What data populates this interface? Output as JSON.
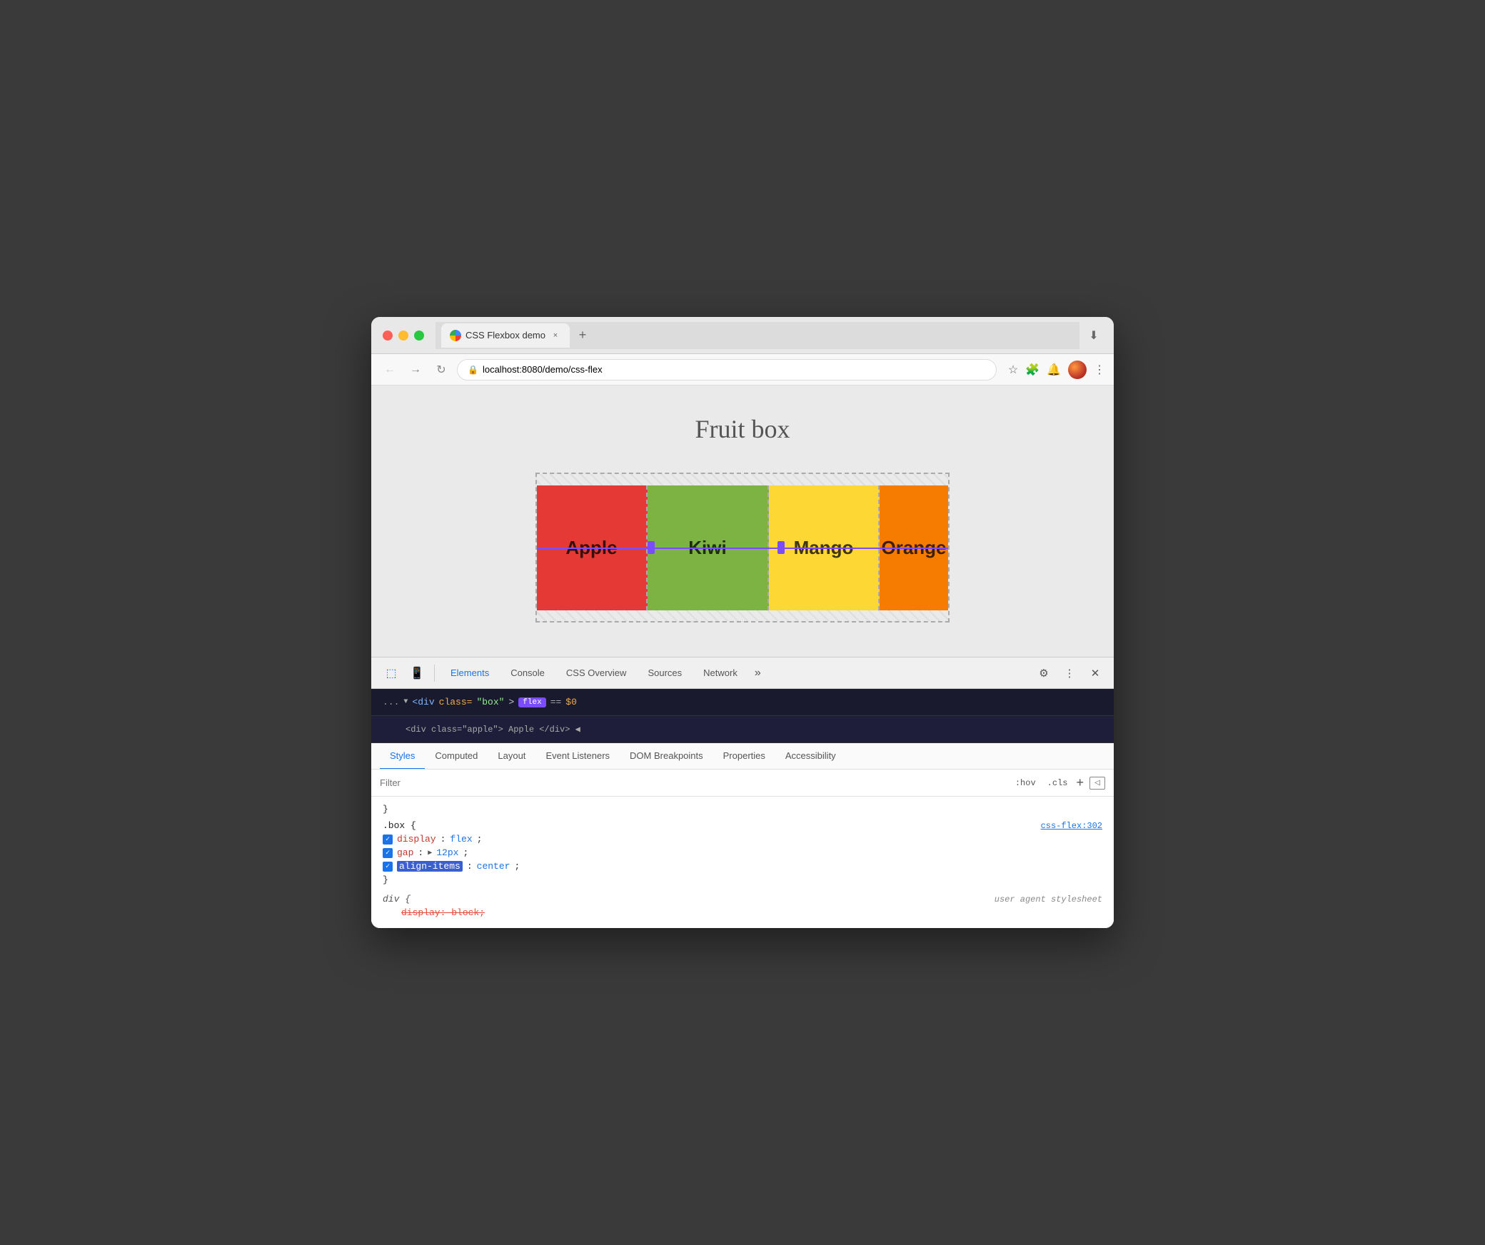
{
  "browser": {
    "tab_title": "CSS Flexbox demo",
    "tab_close": "×",
    "tab_new": "+",
    "url": "localhost:8080/demo/css-flex",
    "url_protocol": "localhost:",
    "url_path": "8080/demo/css-flex"
  },
  "page": {
    "title": "Fruit box",
    "fruits": [
      {
        "name": "Apple",
        "color": "#e53935"
      },
      {
        "name": "Kiwi",
        "color": "#7cb342"
      },
      {
        "name": "Mango",
        "color": "#fdd835"
      },
      {
        "name": "Orange",
        "color": "#f57c00"
      }
    ]
  },
  "devtools": {
    "tabs": [
      "Elements",
      "Console",
      "CSS Overview",
      "Sources",
      "Network"
    ],
    "active_tab": "Elements",
    "dom_ellipsis": "...",
    "dom_tag": "<div",
    "dom_class_attr": "class=",
    "dom_class_value": "\"box\"",
    "dom_close_tag": ">",
    "dom_badge": "flex",
    "dom_equals": "==",
    "dom_dollar": "$0",
    "dom_sub_text": "<div class=\"apple\"> Apple </div> ◀",
    "styles_tabs": [
      "Styles",
      "Computed",
      "Layout",
      "Event Listeners",
      "DOM Breakpoints",
      "Properties",
      "Accessibility"
    ],
    "active_styles_tab": "Styles",
    "filter_placeholder": "Filter",
    "filter_hov": ":hov",
    "filter_cls": ".cls",
    "css_closing_brace": "}",
    "rule1": {
      "selector": ".box {",
      "source": "css-flex:302",
      "properties": [
        {
          "enabled": true,
          "name": "display",
          "value": "flex"
        },
        {
          "enabled": true,
          "name": "gap",
          "value": "▶ 12px"
        },
        {
          "enabled": true,
          "name": "align-items",
          "value": "center",
          "name_highlight": true
        }
      ]
    },
    "rule2": {
      "selector": "div {",
      "source": "user agent stylesheet",
      "properties": [
        {
          "enabled": false,
          "name": "display",
          "value": "block",
          "strikethrough": true
        }
      ]
    }
  }
}
